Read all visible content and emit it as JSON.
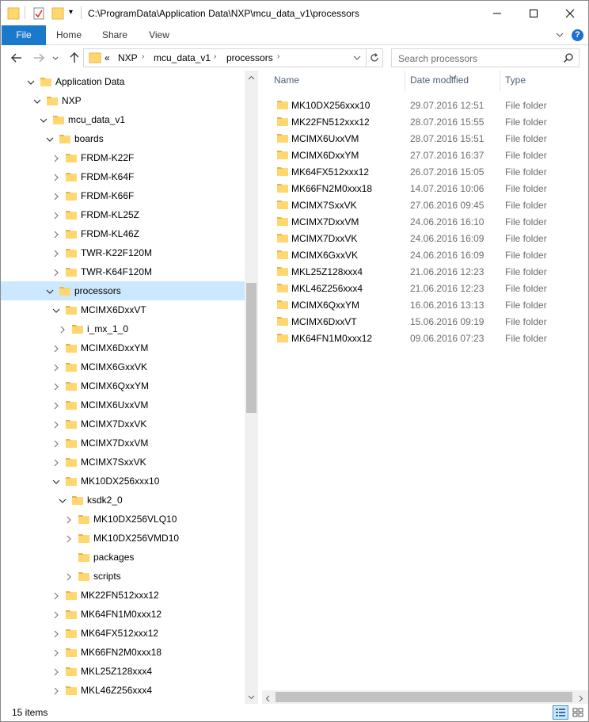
{
  "titlebar": {
    "path": "C:\\ProgramData\\Application Data\\NXP\\mcu_data_v1\\processors",
    "quick_access_dropdown": "▾"
  },
  "ribbon": {
    "tabs": [
      "File",
      "Home",
      "Share",
      "View"
    ],
    "help": "?"
  },
  "nav": {
    "breadcrumb_overflow": "«",
    "breadcrumb": [
      "NXP",
      "mcu_data_v1",
      "processors"
    ],
    "search_placeholder": "Search processors"
  },
  "tree": [
    {
      "label": "Application Data",
      "depth": 0,
      "state": "expanded"
    },
    {
      "label": "NXP",
      "depth": 1,
      "state": "expanded"
    },
    {
      "label": "mcu_data_v1",
      "depth": 2,
      "state": "expanded"
    },
    {
      "label": "boards",
      "depth": 3,
      "state": "expanded"
    },
    {
      "label": "FRDM-K22F",
      "depth": 4,
      "state": "collapsed"
    },
    {
      "label": "FRDM-K64F",
      "depth": 4,
      "state": "collapsed"
    },
    {
      "label": "FRDM-K66F",
      "depth": 4,
      "state": "collapsed"
    },
    {
      "label": "FRDM-KL25Z",
      "depth": 4,
      "state": "collapsed"
    },
    {
      "label": "FRDM-KL46Z",
      "depth": 4,
      "state": "collapsed"
    },
    {
      "label": "TWR-K22F120M",
      "depth": 4,
      "state": "collapsed"
    },
    {
      "label": "TWR-K64F120M",
      "depth": 4,
      "state": "collapsed"
    },
    {
      "label": "processors",
      "depth": 3,
      "state": "expanded",
      "selected": true
    },
    {
      "label": "MCIMX6DxxVT",
      "depth": 4,
      "state": "expanded"
    },
    {
      "label": "i_mx_1_0",
      "depth": 5,
      "state": "collapsed"
    },
    {
      "label": "MCIMX6DxxYM",
      "depth": 4,
      "state": "collapsed"
    },
    {
      "label": "MCIMX6GxxVK",
      "depth": 4,
      "state": "collapsed"
    },
    {
      "label": "MCIMX6QxxYM",
      "depth": 4,
      "state": "collapsed"
    },
    {
      "label": "MCIMX6UxxVM",
      "depth": 4,
      "state": "collapsed"
    },
    {
      "label": "MCIMX7DxxVK",
      "depth": 4,
      "state": "collapsed"
    },
    {
      "label": "MCIMX7DxxVM",
      "depth": 4,
      "state": "collapsed"
    },
    {
      "label": "MCIMX7SxxVK",
      "depth": 4,
      "state": "collapsed"
    },
    {
      "label": "MK10DX256xxx10",
      "depth": 4,
      "state": "expanded"
    },
    {
      "label": "ksdk2_0",
      "depth": 5,
      "state": "expanded"
    },
    {
      "label": "MK10DX256VLQ10",
      "depth": 6,
      "state": "collapsed"
    },
    {
      "label": "MK10DX256VMD10",
      "depth": 6,
      "state": "collapsed"
    },
    {
      "label": "packages",
      "depth": 6,
      "state": "leaf"
    },
    {
      "label": "scripts",
      "depth": 6,
      "state": "collapsed"
    },
    {
      "label": "MK22FN512xxx12",
      "depth": 4,
      "state": "collapsed"
    },
    {
      "label": "MK64FN1M0xxx12",
      "depth": 4,
      "state": "collapsed"
    },
    {
      "label": "MK64FX512xxx12",
      "depth": 4,
      "state": "collapsed"
    },
    {
      "label": "MK66FN2M0xxx18",
      "depth": 4,
      "state": "collapsed"
    },
    {
      "label": "MKL25Z128xxx4",
      "depth": 4,
      "state": "collapsed"
    },
    {
      "label": "MKL46Z256xxx4",
      "depth": 4,
      "state": "collapsed"
    }
  ],
  "list": {
    "columns": {
      "name": "Name",
      "date": "Date modified",
      "type": "Type"
    },
    "rows": [
      {
        "name": "MK10DX256xxx10",
        "date": "29.07.2016 12:51",
        "type": "File folder"
      },
      {
        "name": "MK22FN512xxx12",
        "date": "28.07.2016 15:55",
        "type": "File folder"
      },
      {
        "name": "MCIMX6UxxVM",
        "date": "28.07.2016 15:51",
        "type": "File folder"
      },
      {
        "name": "MCIMX6DxxYM",
        "date": "27.07.2016 16:37",
        "type": "File folder"
      },
      {
        "name": "MK64FX512xxx12",
        "date": "26.07.2016 15:05",
        "type": "File folder"
      },
      {
        "name": "MK66FN2M0xxx18",
        "date": "14.07.2016 10:06",
        "type": "File folder"
      },
      {
        "name": "MCIMX7SxxVK",
        "date": "27.06.2016 09:45",
        "type": "File folder"
      },
      {
        "name": "MCIMX7DxxVM",
        "date": "24.06.2016 16:10",
        "type": "File folder"
      },
      {
        "name": "MCIMX7DxxVK",
        "date": "24.06.2016 16:09",
        "type": "File folder"
      },
      {
        "name": "MCIMX6GxxVK",
        "date": "24.06.2016 16:09",
        "type": "File folder"
      },
      {
        "name": "MKL25Z128xxx4",
        "date": "21.06.2016 12:23",
        "type": "File folder"
      },
      {
        "name": "MKL46Z256xxx4",
        "date": "21.06.2016 12:23",
        "type": "File folder"
      },
      {
        "name": "MCIMX6QxxYM",
        "date": "16.06.2016 13:13",
        "type": "File folder"
      },
      {
        "name": "MCIMX6DxxVT",
        "date": "15.06.2016 09:19",
        "type": "File folder"
      },
      {
        "name": "MK64FN1M0xxx12",
        "date": "09.06.2016 07:23",
        "type": "File folder"
      }
    ]
  },
  "status": {
    "item_count": "15 items"
  },
  "colors": {
    "accent": "#1979ca",
    "selection": "#cce8ff",
    "folder": "#ffd76e",
    "folder_dark": "#e9b43f"
  },
  "icons": [
    "folder-icon",
    "properties-icon",
    "new-folder-icon",
    "minimize-icon",
    "maximize-icon",
    "close-icon",
    "back-arrow-icon",
    "forward-arrow-icon",
    "recent-locations-icon",
    "up-arrow-icon",
    "refresh-icon",
    "search-icon",
    "details-view-icon",
    "large-icons-view-icon"
  ]
}
